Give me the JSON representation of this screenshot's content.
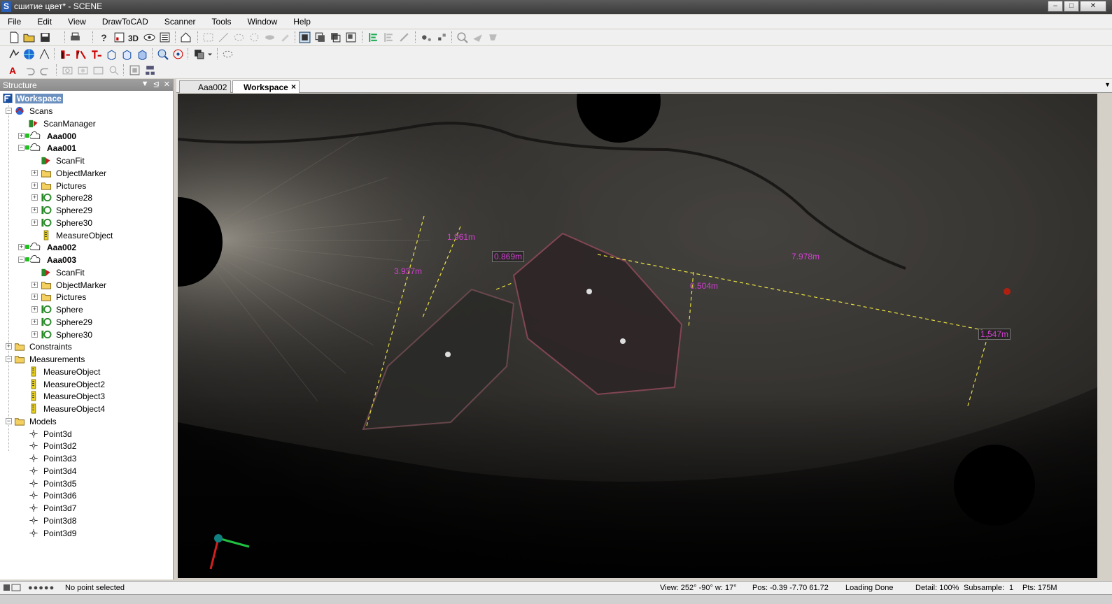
{
  "window": {
    "title": "сшитие цвет* - SCENE"
  },
  "menu": [
    "File",
    "Edit",
    "View",
    "DrawToCAD",
    "Scanner",
    "Tools",
    "Window",
    "Help"
  ],
  "structure_panel": {
    "title": "Structure",
    "root": "Workspace",
    "tree": [
      {
        "label": "Scans",
        "depth": 1,
        "icon": "scans-icon",
        "expander": "-"
      },
      {
        "label": "ScanManager",
        "depth": 2,
        "icon": "scanmanager-icon"
      },
      {
        "label": "Aaa000",
        "depth": 2,
        "icon": "scan-cloud-icon",
        "expander": "+",
        "bold": true
      },
      {
        "label": "Aaa001",
        "depth": 2,
        "icon": "scan-cloud-icon",
        "expander": "-",
        "bold": true
      },
      {
        "label": "ScanFit",
        "depth": 3,
        "icon": "scanfit-icon"
      },
      {
        "label": "ObjectMarker",
        "depth": 3,
        "icon": "folder-icon",
        "expander": "+"
      },
      {
        "label": "Pictures",
        "depth": 3,
        "icon": "folder-icon",
        "expander": "+"
      },
      {
        "label": "Sphere28",
        "depth": 3,
        "icon": "sphere-icon",
        "expander": "+"
      },
      {
        "label": "Sphere29",
        "depth": 3,
        "icon": "sphere-icon",
        "expander": "+"
      },
      {
        "label": "Sphere30",
        "depth": 3,
        "icon": "sphere-icon",
        "expander": "+"
      },
      {
        "label": "MeasureObject",
        "depth": 3,
        "icon": "measure-icon"
      },
      {
        "label": "Aaa002",
        "depth": 2,
        "icon": "scan-cloud-icon",
        "expander": "+",
        "bold": true
      },
      {
        "label": "Aaa003",
        "depth": 2,
        "icon": "scan-cloud-icon",
        "expander": "-",
        "bold": true
      },
      {
        "label": "ScanFit",
        "depth": 3,
        "icon": "scanfit-icon"
      },
      {
        "label": "ObjectMarker",
        "depth": 3,
        "icon": "folder-icon",
        "expander": "+"
      },
      {
        "label": "Pictures",
        "depth": 3,
        "icon": "folder-icon",
        "expander": "+"
      },
      {
        "label": "Sphere",
        "depth": 3,
        "icon": "sphere-icon",
        "expander": "+"
      },
      {
        "label": "Sphere29",
        "depth": 3,
        "icon": "sphere-icon",
        "expander": "+"
      },
      {
        "label": "Sphere30",
        "depth": 3,
        "icon": "sphere-icon",
        "expander": "+"
      },
      {
        "label": "Constraints",
        "depth": 1,
        "icon": "folder-icon",
        "expander": "+"
      },
      {
        "label": "Measurements",
        "depth": 1,
        "icon": "folder-icon",
        "expander": "-"
      },
      {
        "label": "MeasureObject",
        "depth": 2,
        "icon": "measure-icon"
      },
      {
        "label": "MeasureObject2",
        "depth": 2,
        "icon": "measure-icon"
      },
      {
        "label": "MeasureObject3",
        "depth": 2,
        "icon": "measure-icon"
      },
      {
        "label": "MeasureObject4",
        "depth": 2,
        "icon": "measure-icon"
      },
      {
        "label": "Models",
        "depth": 1,
        "icon": "folder-icon",
        "expander": "-"
      },
      {
        "label": "Point3d",
        "depth": 2,
        "icon": "point3d-icon"
      },
      {
        "label": "Point3d2",
        "depth": 2,
        "icon": "point3d-icon"
      },
      {
        "label": "Point3d3",
        "depth": 2,
        "icon": "point3d-icon"
      },
      {
        "label": "Point3d4",
        "depth": 2,
        "icon": "point3d-icon"
      },
      {
        "label": "Point3d5",
        "depth": 2,
        "icon": "point3d-icon"
      },
      {
        "label": "Point3d6",
        "depth": 2,
        "icon": "point3d-icon"
      },
      {
        "label": "Point3d7",
        "depth": 2,
        "icon": "point3d-icon"
      },
      {
        "label": "Point3d8",
        "depth": 2,
        "icon": "point3d-icon"
      },
      {
        "label": "Point3d9",
        "depth": 2,
        "icon": "point3d-icon"
      }
    ]
  },
  "tabs": [
    {
      "label": "Aaa002",
      "active": false
    },
    {
      "label": "Workspace",
      "active": true,
      "close": "×"
    }
  ],
  "viewport": {
    "measurements": [
      "1.961m",
      "3.937m",
      "0.869m",
      "7.978m",
      "0.504m",
      "1.547m"
    ]
  },
  "status": {
    "selection": "No point selected",
    "view": "View: 252° -90° w: 17°",
    "pos": "Pos:  -0.39  -7.70  61.72",
    "loading": "Loading Done",
    "detail": "Detail: 100%",
    "subsample": "Subsample:",
    "subsample_value": "1",
    "pts": "Pts: 175M"
  },
  "colors": {
    "measure_text": "#d040d0",
    "measure_line": "#e8e040",
    "selection": "#6b8fbf"
  }
}
